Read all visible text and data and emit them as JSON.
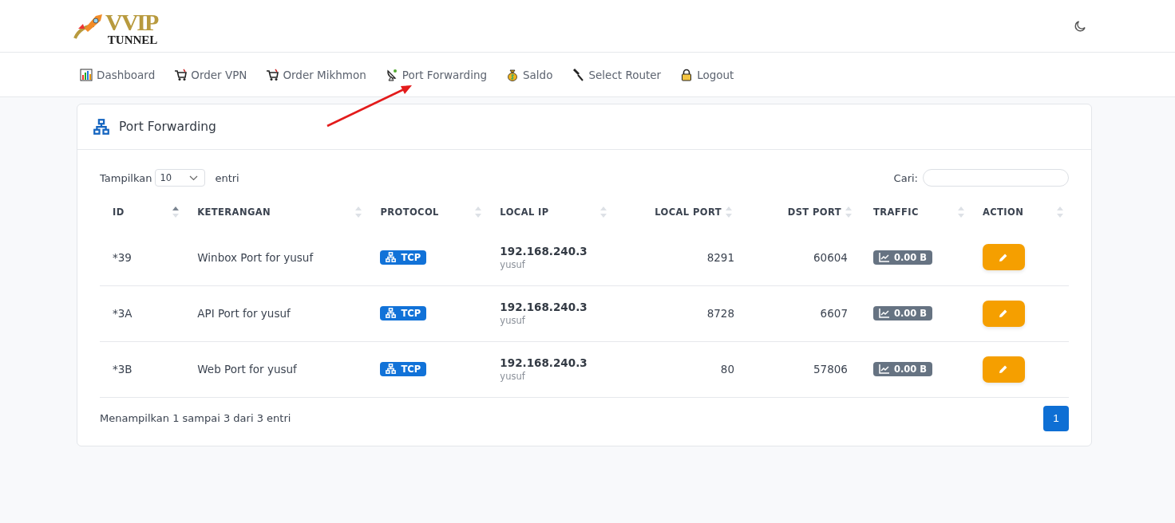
{
  "logo": {
    "word": "VVIP",
    "subword": "TUNNEL"
  },
  "nav": [
    {
      "label": "Dashboard"
    },
    {
      "label": "Order VPN"
    },
    {
      "label": "Order Mikhmon"
    },
    {
      "label": "Port Forwarding"
    },
    {
      "label": "Saldo"
    },
    {
      "label": "Select Router"
    },
    {
      "label": "Logout"
    }
  ],
  "card": {
    "title": "Port Forwarding"
  },
  "length_control": {
    "prefix": "Tampilkan",
    "value": "10",
    "suffix": "entri"
  },
  "search": {
    "label": "Cari:"
  },
  "table": {
    "columns": [
      {
        "label": "ID",
        "sorted": true
      },
      {
        "label": "KETERANGAN",
        "sorted": false
      },
      {
        "label": "PROTOCOL",
        "sorted": false
      },
      {
        "label": "LOCAL IP",
        "sorted": false
      },
      {
        "label": "LOCAL PORT",
        "sorted": false
      },
      {
        "label": "DST PORT",
        "sorted": false
      },
      {
        "label": "TRAFFIC",
        "sorted": false
      },
      {
        "label": "ACTION",
        "sorted": false
      }
    ],
    "rows": [
      {
        "id": "*39",
        "description": "Winbox Port for yusuf",
        "protocol": "TCP",
        "local_ip": "192.168.240.3",
        "user": "yusuf",
        "local_port": "8291",
        "dst_port": "60604",
        "traffic": "0.00 B"
      },
      {
        "id": "*3A",
        "description": "API Port for yusuf",
        "protocol": "TCP",
        "local_ip": "192.168.240.3",
        "user": "yusuf",
        "local_port": "8728",
        "dst_port": "6607",
        "traffic": "0.00 B"
      },
      {
        "id": "*3B",
        "description": "Web Port for yusuf",
        "protocol": "TCP",
        "local_ip": "192.168.240.3",
        "user": "yusuf",
        "local_port": "80",
        "dst_port": "57806",
        "traffic": "0.00 B"
      }
    ]
  },
  "info": "Menampilkan 1 sampai 3 dari 3 entri",
  "pagination": [
    {
      "label": "1",
      "selected": true
    }
  ]
}
